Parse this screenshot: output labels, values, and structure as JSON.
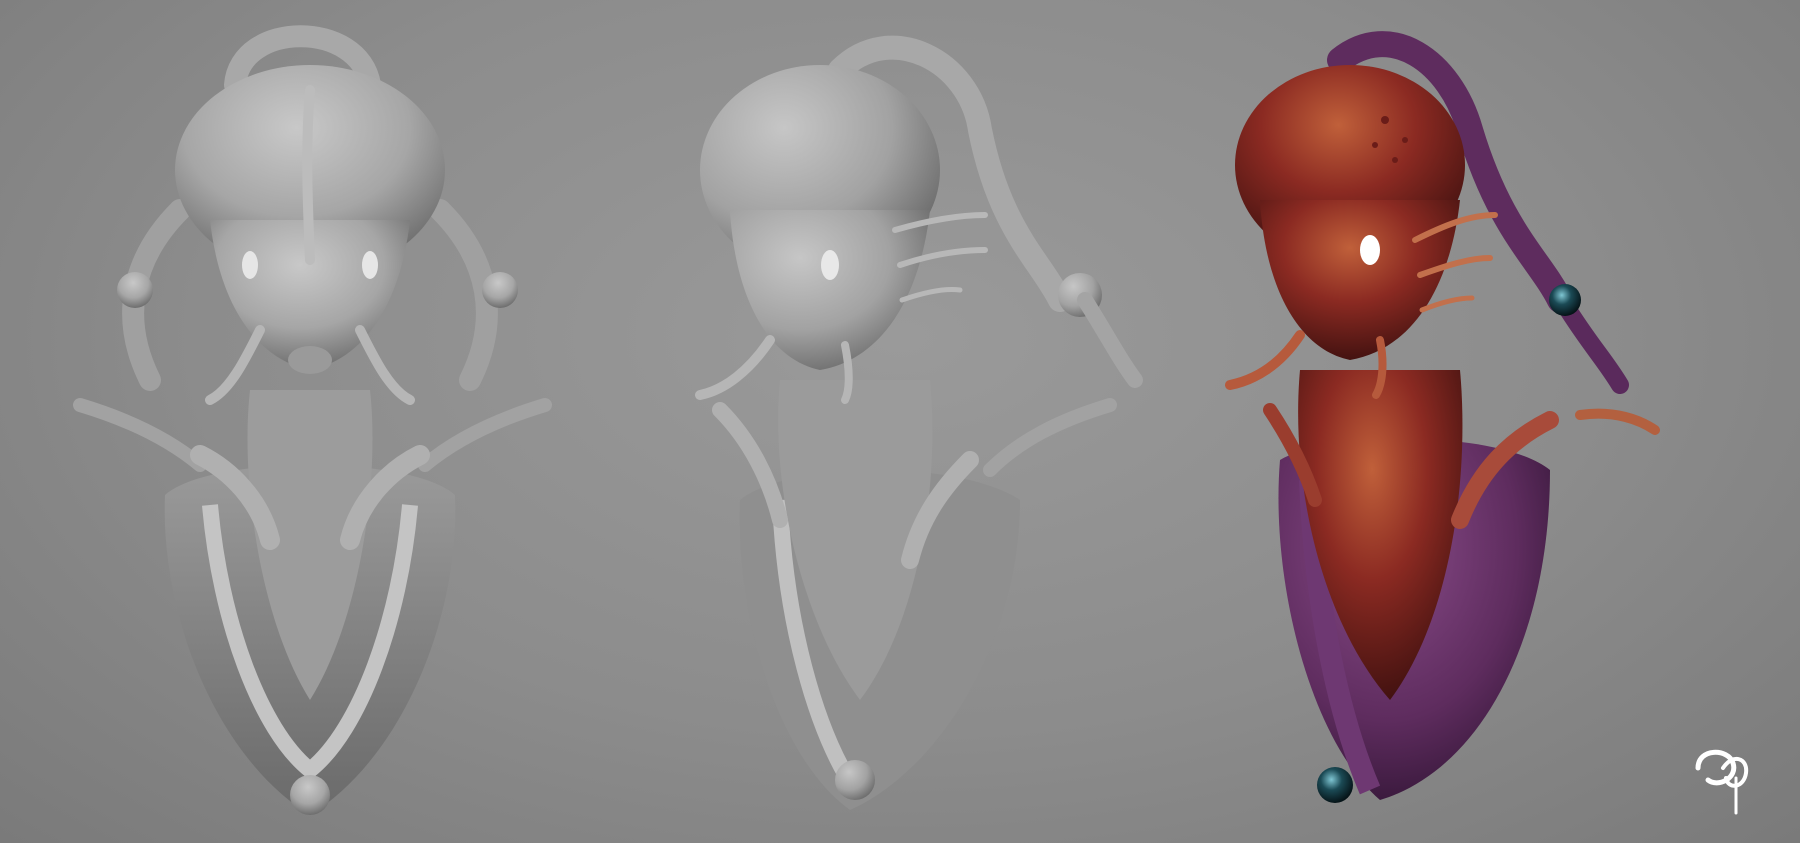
{
  "scene": {
    "background_color": "#8e8e8e",
    "renders": [
      {
        "name": "front-view-clay-render",
        "material": "clay",
        "color": "#a9a9a9"
      },
      {
        "name": "three-quarter-clay-render",
        "material": "clay",
        "color": "#a4a4a4"
      },
      {
        "name": "three-quarter-painted-render",
        "material": "painted",
        "skin_color": "#8a2a22",
        "armor_color": "#5e2c5e",
        "eye_gem_color": "#1b4a55"
      }
    ],
    "artist_signature": {
      "kind": "logo",
      "color": "#ffffff"
    }
  }
}
